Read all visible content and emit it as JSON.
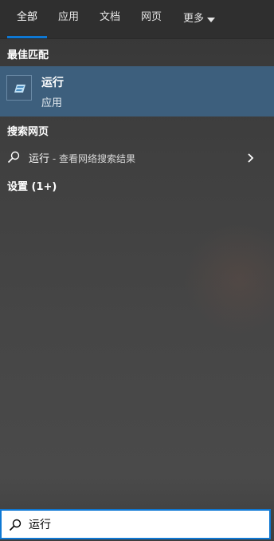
{
  "tabs": [
    {
      "label": "全部",
      "active": true
    },
    {
      "label": "应用",
      "active": false
    },
    {
      "label": "文档",
      "active": false
    },
    {
      "label": "网页",
      "active": false
    },
    {
      "label": "更多",
      "active": false
    }
  ],
  "best_match": {
    "heading": "最佳匹配",
    "title": "运行",
    "subtitle": "应用",
    "icon": "run-app-icon"
  },
  "web_search": {
    "heading": "搜索网页",
    "query": "运行",
    "suffix": " - 查看网络搜索结果"
  },
  "settings": {
    "heading": "设置 (1+)"
  },
  "search_box": {
    "value": "运行",
    "icon": "search-icon"
  },
  "colors": {
    "accent": "#0e78d4",
    "selected_row": "#3d5f7d",
    "background": "#404040"
  }
}
